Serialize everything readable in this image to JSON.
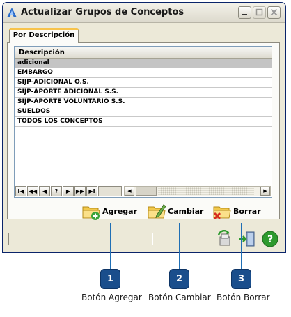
{
  "window": {
    "title": "Actualizar Grupos de Conceptos",
    "tab_label": "Por Descripción"
  },
  "grid": {
    "column_header": "Descripción",
    "rows": [
      "adicional",
      "EMBARGO",
      "SIJP-ADICIONAL O.S.",
      "SIJP-APORTE ADICIONAL S.S.",
      "SIJP-APORTE VOLUNTARIO S.S.",
      "SUELDOS",
      "TODOS LOS CONCEPTOS"
    ],
    "selected_row": "adicional"
  },
  "navigator": {
    "first": "I◀",
    "prev_page": "◀◀",
    "prev": "◀",
    "search": "?",
    "next": "▶",
    "next_page": "▶▶",
    "last": "▶I"
  },
  "actions": {
    "add_first": "A",
    "add_rest": "gregar",
    "change_first": "C",
    "change_rest": "ambiar",
    "delete_first": "B",
    "delete_rest": "orrar"
  },
  "callouts": [
    {
      "number": "1",
      "label": "Botón Agregar"
    },
    {
      "number": "2",
      "label": "Botón Cambiar"
    },
    {
      "number": "3",
      "label": "Botón Borrar"
    }
  ],
  "colors": {
    "accent": "#1a4e8c",
    "callout_line": "#1f6fb5",
    "window_bg": "#ece9d8",
    "help_icon": "#2e9a2e"
  },
  "icons": [
    "app-icon",
    "minimize-icon",
    "maximize-icon",
    "close-icon",
    "folder-add-icon",
    "folder-edit-icon",
    "folder-delete-icon",
    "refresh-icon",
    "exit-icon",
    "help-icon"
  ]
}
